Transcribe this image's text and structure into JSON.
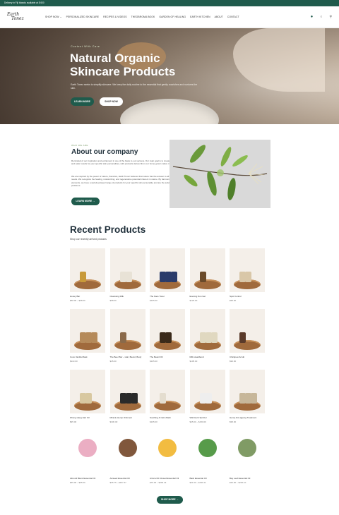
{
  "announcement": "Delivery in Fiji Islands available at $ 600",
  "logo": {
    "line1": "Earth",
    "line2": "Tonez"
  },
  "nav": {
    "items": [
      "SHOP NOW ⌄",
      "PERSONALIZED SKINCARE",
      "RECIPES & VIDEOS",
      "THEOBROMA BOOK",
      "GARDEN OF HEALING",
      "EARTH KITCHEN",
      "ABOUT",
      "CONTACT"
    ]
  },
  "hero": {
    "kicker": "Content With Care",
    "title_line1": "Natural Organic",
    "title_line2": "Skincare Products",
    "description": "Earth Tonez seeks to simplify skincare. We keep the daily routine to the essential that gently nourishes and nurtures the skin.",
    "learn_more": "LEARN MORE",
    "shop_now": "SHOP NOW"
  },
  "about": {
    "kicker": "WHO WE ARE",
    "title": "About our company",
    "p1": "Reminded of our inspiration and excitement in one of the basis to our success. Our main goal is to create high quality and safer results for your specific skin personalities, with products derived from our home-grown native ingredients.",
    "p2": "We are inspired by the power of nature, therefore, Earth Tonez believes that nature has the answer to all our beauty needs. We recognize the healing, moisturizing, and regenerative potential inherent in nature. By harmonizing these elements, we have a well-developed range of products for your specific skin personality and are the solution to all skin problems.",
    "learn_more": "LEARN MORE →"
  },
  "recent": {
    "title": "Recent Products",
    "subtitle": "Shop our recently arrived products"
  },
  "products": [
    {
      "name": "Honey Bar",
      "price": "$68.00 – $68.00"
    },
    {
      "name": "Cleansing Milk",
      "price": "$68.00"
    },
    {
      "name": "The Face Toner",
      "price": "$105.00"
    },
    {
      "name": "Evening Sun Gel",
      "price": "$120.00"
    },
    {
      "name": "Spot Control",
      "price": "$95.00"
    },
    {
      "name": "Coco Vanilla Mask",
      "price": "$110.00"
    },
    {
      "name": "The Beer Bar – Hair, Beard, Body",
      "price": "$45.00"
    },
    {
      "name": "The Beard Oil",
      "price": "$105.00"
    },
    {
      "name": "Milk Headband",
      "price": "$105.00"
    },
    {
      "name": "Chickpea Scrub",
      "price": "$90.00"
    },
    {
      "name": "Wrong Hang Hair Oil",
      "price": "$95.00"
    },
    {
      "name": "Miracle Hemp Ointment",
      "price": "$330.00"
    },
    {
      "name": "Soothing & Calm Balm",
      "price": "$105.00"
    },
    {
      "name": "Wild Herb Spritzer",
      "price": "$45.00 – $150.00"
    },
    {
      "name": "Hemp Anti-ageing Treatment",
      "price": "$95.00"
    },
    {
      "name": "Almond Blend Essential Oil",
      "price": "$35.00 – $65.00"
    },
    {
      "name": "Aniseed Essential Oil",
      "price": "$35.75 – $267.37"
    },
    {
      "name": "Arnica Oil Infused Essential Oil",
      "price": "$76.00 – $393.43"
    },
    {
      "name": "Basil Essential Oil",
      "price": "$41.00 – $190.11"
    },
    {
      "name": "Bay Leaf Essential Oil",
      "price": "$32.00 – $240.10"
    }
  ],
  "shop_more": "SHOP MORE →",
  "colors": {
    "brand_green": "#1f5b4c",
    "topbar": "#1f5b4c"
  }
}
